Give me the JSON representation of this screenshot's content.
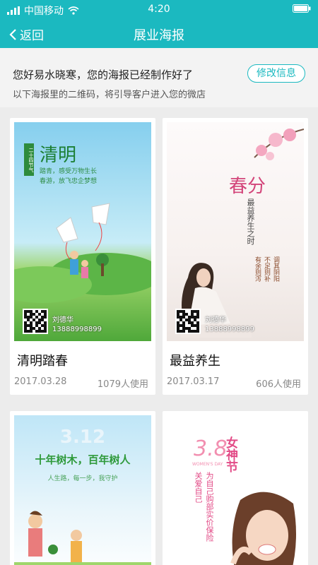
{
  "status_bar": {
    "carrier": "中国移动",
    "time": "4:20",
    "icons": [
      "signal-icon",
      "wifi-icon",
      "battery-icon"
    ]
  },
  "nav": {
    "back_label": "返回",
    "title": "展业海报"
  },
  "info": {
    "greeting": "您好易水晓寒，您的海报已经制作好了",
    "hint": "以下海报里的二维码，将引导客户进入您的微店",
    "edit_button": "修改信息"
  },
  "colors": {
    "accent": "#1bb9c0",
    "background": "#ececec"
  },
  "posters": [
    {
      "name": "清明踏春",
      "date": "2017.03.28",
      "usage": "1079人使用",
      "poster_title": "清明",
      "poster_tag": "二十四节气",
      "poster_lines": [
        "踏青，感受万物生长",
        "春游，放飞忠企梦想"
      ],
      "contact_name": "刘德华",
      "contact_phone": "13888998899"
    },
    {
      "name": "最益养生",
      "date": "2017.03.17",
      "usage": "606人使用",
      "poster_title": "春分",
      "poster_lines": [
        "最益养生之时",
        "调其阴阳",
        "不足则补",
        "有余则泻"
      ],
      "contact_name": "刘德华",
      "contact_phone": "13888998899"
    },
    {
      "poster_top": "3.12",
      "poster_title": "十年树木，百年树人",
      "poster_sub": "人生路，每一步，我守护"
    },
    {
      "poster_top": "3.8",
      "poster_top_sub": "WOMEN'S DAY",
      "poster_title": "女神节",
      "poster_lines": [
        "关爱自己",
        "为自己购部实价保险"
      ]
    }
  ]
}
